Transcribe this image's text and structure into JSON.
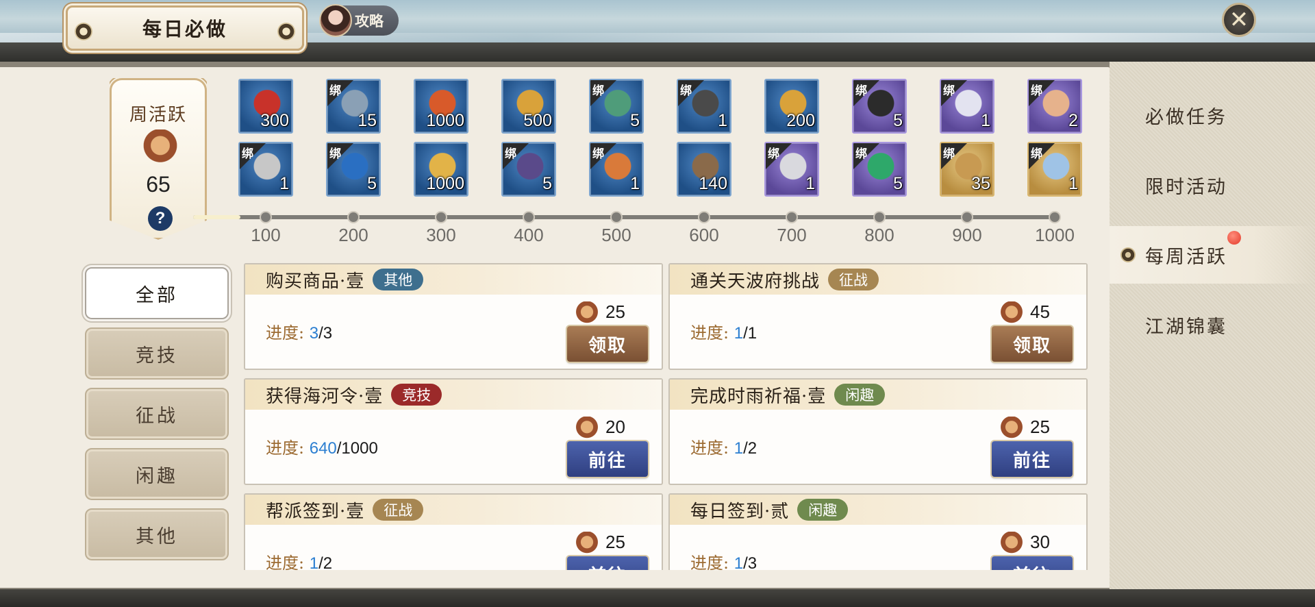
{
  "header": {
    "title": "每日必做",
    "guide_label": "攻略",
    "close_symbol": "✕"
  },
  "weekly": {
    "title": "周活跃",
    "value": "65",
    "help": "?",
    "current": 65,
    "max": 1000
  },
  "rewards_row1": [
    {
      "qty": "300",
      "bound": false,
      "rarity": "blue",
      "icon": "tribute-token-icon",
      "art": "#c8322a"
    },
    {
      "qty": "15",
      "bound": true,
      "rarity": "blue",
      "icon": "hidden-weapon-icon",
      "art": "#8aa0b5"
    },
    {
      "qty": "1000",
      "bound": false,
      "rarity": "blue",
      "icon": "victory-token-icon",
      "art": "#d85a2a"
    },
    {
      "qty": "500",
      "bound": false,
      "rarity": "blue",
      "icon": "gold-tag-icon",
      "art": "#d9a23a"
    },
    {
      "qty": "5",
      "bound": true,
      "rarity": "blue",
      "icon": "jade-token-icon",
      "art": "#4f9c7a"
    },
    {
      "qty": "1",
      "bound": true,
      "rarity": "blue",
      "icon": "armor-piece-icon",
      "art": "#4a4a4a"
    },
    {
      "qty": "200",
      "bound": false,
      "rarity": "blue",
      "icon": "gold-pendant-icon",
      "art": "#d9a23a"
    },
    {
      "qty": "5",
      "bound": true,
      "rarity": "purple",
      "icon": "treasure-chest-icon",
      "art": "#2b2b2b"
    },
    {
      "qty": "1",
      "bound": true,
      "rarity": "purple",
      "icon": "scroll-book-icon",
      "art": "#e3e3f0"
    },
    {
      "qty": "2",
      "bound": true,
      "rarity": "purple",
      "icon": "letters-icon",
      "art": "#e6b28c"
    }
  ],
  "rewards_row2": [
    {
      "qty": "1",
      "bound": true,
      "rarity": "blue",
      "icon": "silver-coins-icon",
      "art": "#c7c7c7"
    },
    {
      "qty": "5",
      "bound": true,
      "rarity": "blue",
      "icon": "upgrade-orb-icon",
      "art": "#2a6fc2"
    },
    {
      "qty": "1000",
      "bound": false,
      "rarity": "blue",
      "icon": "gold-ingot-icon",
      "art": "#e2b348"
    },
    {
      "qty": "5",
      "bound": true,
      "rarity": "blue",
      "icon": "outfit-icon",
      "art": "#5a4a8a"
    },
    {
      "qty": "1",
      "bound": true,
      "rarity": "blue",
      "icon": "gift-box-icon",
      "art": "#d97a3a"
    },
    {
      "qty": "140",
      "bound": false,
      "rarity": "blue",
      "icon": "timber-icon",
      "art": "#8a6a4a"
    },
    {
      "qty": "1",
      "bound": true,
      "rarity": "purple",
      "icon": "silver-ingot-icon",
      "art": "#d9d9de"
    },
    {
      "qty": "5",
      "bound": true,
      "rarity": "purple",
      "icon": "jade-ring-icon",
      "art": "#2ea86a"
    },
    {
      "qty": "35",
      "bound": true,
      "rarity": "gold",
      "icon": "hero-token-icon",
      "art": "#c89a52"
    },
    {
      "qty": "1",
      "bound": true,
      "rarity": "gold",
      "icon": "scroll-icon",
      "art": "#9fc3e6"
    }
  ],
  "bind_label": "绑",
  "milestones": [
    "100",
    "200",
    "300",
    "400",
    "500",
    "600",
    "700",
    "800",
    "900",
    "1000"
  ],
  "categories": [
    {
      "label": "全部",
      "active": true
    },
    {
      "label": "竞技",
      "active": false
    },
    {
      "label": "征战",
      "active": false
    },
    {
      "label": "闲趣",
      "active": false
    },
    {
      "label": "其他",
      "active": false
    }
  ],
  "right_menu": [
    {
      "label": "必做任务",
      "active": false
    },
    {
      "label": "限时活动",
      "active": false
    },
    {
      "label": "每周活跃",
      "active": true
    },
    {
      "label": "江湖锦囊",
      "active": false
    }
  ],
  "tasks": [
    {
      "name": "购买商品·壹",
      "tag": "其他",
      "tag_color": "#3e6f8e",
      "progress_label": "进度:",
      "cur": "3",
      "tot": "/3",
      "reward": "25",
      "button": "领取",
      "btn_type": "claim"
    },
    {
      "name": "通关天波府挑战",
      "tag": "征战",
      "tag_color": "#a68652",
      "progress_label": "进度:",
      "cur": "1",
      "tot": "/1",
      "reward": "45",
      "button": "领取",
      "btn_type": "claim"
    },
    {
      "name": "获得海河令·壹",
      "tag": "竞技",
      "tag_color": "#9b2a2a",
      "progress_label": "进度:",
      "cur": "640",
      "tot": "/1000",
      "reward": "20",
      "button": "前往",
      "btn_type": "go"
    },
    {
      "name": "完成时雨祈福·壹",
      "tag": "闲趣",
      "tag_color": "#6f8a4e",
      "progress_label": "进度:",
      "cur": "1",
      "tot": "/2",
      "reward": "25",
      "button": "前往",
      "btn_type": "go"
    },
    {
      "name": "帮派签到·壹",
      "tag": "征战",
      "tag_color": "#a68652",
      "progress_label": "进度:",
      "cur": "1",
      "tot": "/2",
      "reward": "25",
      "button": "前往",
      "btn_type": "go"
    },
    {
      "name": "每日签到·贰",
      "tag": "闲趣",
      "tag_color": "#6f8a4e",
      "progress_label": "进度:",
      "cur": "1",
      "tot": "/3",
      "reward": "30",
      "button": "前往",
      "btn_type": "go"
    }
  ]
}
